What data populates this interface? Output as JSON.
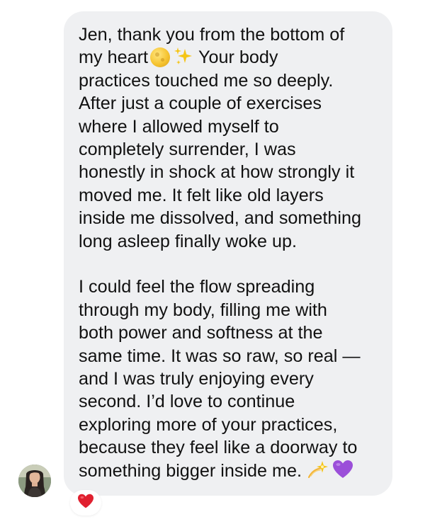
{
  "message": {
    "paragraph1": [
      "Jen, thank you from the bottom of",
      [
        "my heart",
        "Your body"
      ],
      "practices touched me so deeply.",
      "After just a couple of exercises",
      "where I allowed myself to",
      "completely surrender, I was",
      "honestly in shock at how strongly it",
      "moved me. It felt like old layers",
      "inside me dissolved, and something",
      "long asleep finally woke up."
    ],
    "paragraph2": [
      "I could feel the flow spreading",
      "through my body, filling me with",
      "both power and softness at the",
      "same time. It was so raw, so real —",
      "and I was truly enjoying every",
      "second. I’d love to continue",
      "exploring more of your practices,",
      "because they feel like a doorway to",
      "something bigger inside me."
    ],
    "emojis": {
      "line2": [
        "moon-icon",
        "sparkles-icon"
      ],
      "last_line": [
        "dizzy-icon",
        "purple-heart-icon"
      ]
    }
  },
  "reaction": {
    "icon": "red-heart-icon",
    "color": "#e0202f"
  },
  "colors": {
    "bubble": "#eff0f2",
    "text": "#111111",
    "background": "#ffffff"
  }
}
